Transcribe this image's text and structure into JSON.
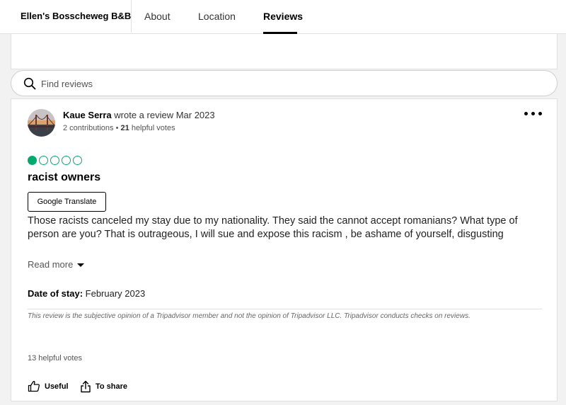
{
  "nav": {
    "brand": "Ellen's Bosscheweg B&B",
    "tabs": [
      "About",
      "Location",
      "Reviews"
    ],
    "active_tab": "Reviews"
  },
  "search": {
    "placeholder": "Find reviews",
    "icon": "search-icon"
  },
  "review": {
    "reviewer_name": "Kaue Serra",
    "action_text": " wrote a review Mar 2023",
    "contributions": "2 contributions",
    "separator": " • ",
    "helpful_count": "21",
    "helpful_suffix": " helpful votes",
    "rating": 1,
    "rating_max": 5,
    "rating_color": "#00aa6c",
    "title": "racist owners",
    "translate_label": "Google Translate",
    "body": "Those racists canceled my stay due to my nationality. They said the cannot accept romanians? What type of person are you? That is outrageous, I will sue and expose this racism , be ashame of yourself, disgusting",
    "read_more": "Read more",
    "date_label": "Date of stay:",
    "date_value": " February 2023",
    "disclaimer": "This review is the subjective opinion of a Tripadvisor member and not the opinion of Tripadvisor LLC. Tripadvisor conducts checks on reviews.",
    "helpful_votes": "13 helpful votes",
    "useful_label": "Useful",
    "share_label": "To share"
  }
}
